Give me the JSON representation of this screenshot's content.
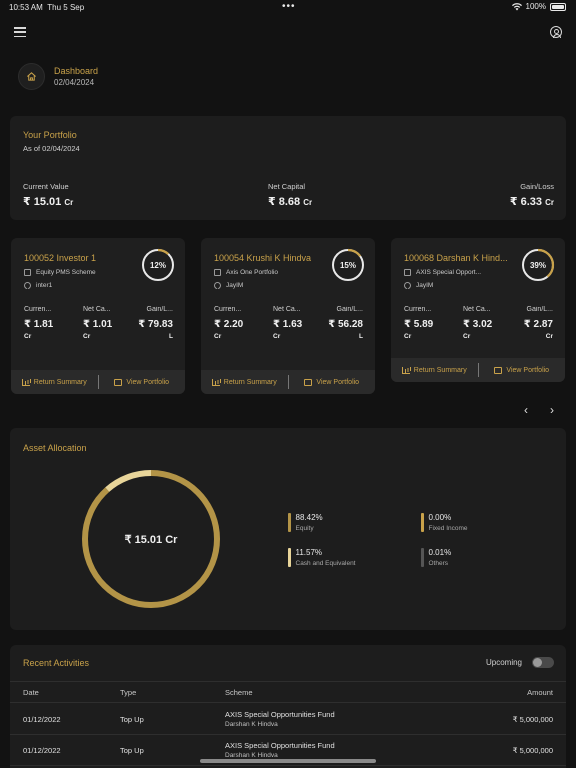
{
  "status_bar": {
    "time": "10:53 AM",
    "date": "Thu 5 Sep",
    "battery": "100%"
  },
  "breadcrumb": {
    "title": "Dashboard",
    "date": "02/04/2024"
  },
  "colors": {
    "accent": "#c9a24a",
    "accent_light": "#e8d59a",
    "background": "#121212",
    "card": "#1d1d1d"
  },
  "portfolio": {
    "title": "Your Portfolio",
    "as_of": "As of 02/04/2024",
    "currency": "₹",
    "metrics": [
      {
        "label": "Current Value",
        "value": "15.01",
        "unit": "Cr"
      },
      {
        "label": "Net Capital",
        "value": "8.68",
        "unit": "Cr"
      },
      {
        "label": "Gain/Loss",
        "value": "6.33",
        "unit": "Cr"
      }
    ]
  },
  "investors": [
    {
      "name": "100052 Investor 1",
      "scheme": "Equity PMS Scheme",
      "tag": "inter1",
      "percent": "12%",
      "percent_value": 12,
      "metrics": [
        {
          "label": "Curren...",
          "value": "₹ 1.81",
          "unit": "Cr"
        },
        {
          "label": "Net Ca...",
          "value": "₹ 1.01",
          "unit": "Cr"
        },
        {
          "label": "Gain/L...",
          "value": "₹ 79.83",
          "unit": "L"
        }
      ]
    },
    {
      "name": "100054 Krushi K Hindva",
      "scheme": "Axis One Portfolio",
      "tag": "JayIM",
      "percent": "15%",
      "percent_value": 15,
      "metrics": [
        {
          "label": "Curren...",
          "value": "₹ 2.20",
          "unit": "Cr"
        },
        {
          "label": "Net Ca...",
          "value": "₹ 1.63",
          "unit": "Cr"
        },
        {
          "label": "Gain/L...",
          "value": "₹ 56.28",
          "unit": "L"
        }
      ]
    },
    {
      "name": "100068 Darshan K Hind...",
      "scheme": "AXIS Special Opport...",
      "tag": "JayIM",
      "percent": "39%",
      "percent_value": 39,
      "metrics": [
        {
          "label": "Curren...",
          "value": "₹ 5.89",
          "unit": "Cr"
        },
        {
          "label": "Net Ca...",
          "value": "₹ 3.02",
          "unit": "Cr"
        },
        {
          "label": "Gain/L...",
          "value": "₹ 2.87",
          "unit": "Cr"
        }
      ]
    }
  ],
  "card_actions": {
    "return_summary": "Return Summary",
    "view_portfolio": "View Portfolio"
  },
  "pager": {
    "prev": "‹",
    "next": "›"
  },
  "asset_allocation": {
    "title": "Asset Allocation",
    "total": "₹ 15.01 Cr",
    "items": [
      {
        "percent": "88.42%",
        "name": "Equity",
        "value": 88.42,
        "color": "#b39447"
      },
      {
        "percent": "0.00%",
        "name": "Fixed Income",
        "value": 0.0,
        "color": "#c9a24a"
      },
      {
        "percent": "11.57%",
        "name": "Cash and Equivalent",
        "value": 11.57,
        "color": "#e8d59a"
      },
      {
        "percent": "0.01%",
        "name": "Others",
        "value": 0.01,
        "color": "#555555"
      }
    ]
  },
  "recent": {
    "title": "Recent Activities",
    "upcoming_label": "Upcoming",
    "columns": {
      "date": "Date",
      "type": "Type",
      "scheme": "Scheme",
      "amount": "Amount"
    },
    "rows": [
      {
        "date": "01/12/2022",
        "type": "Top Up",
        "scheme": "AXIS Special Opportunities Fund",
        "investor": "Darshan K Hindva",
        "amount": "₹ 5,000,000"
      },
      {
        "date": "01/12/2022",
        "type": "Top Up",
        "scheme": "AXIS Special Opportunities Fund",
        "investor": "Darshan K Hindva",
        "amount": "₹ 5,000,000"
      }
    ]
  }
}
